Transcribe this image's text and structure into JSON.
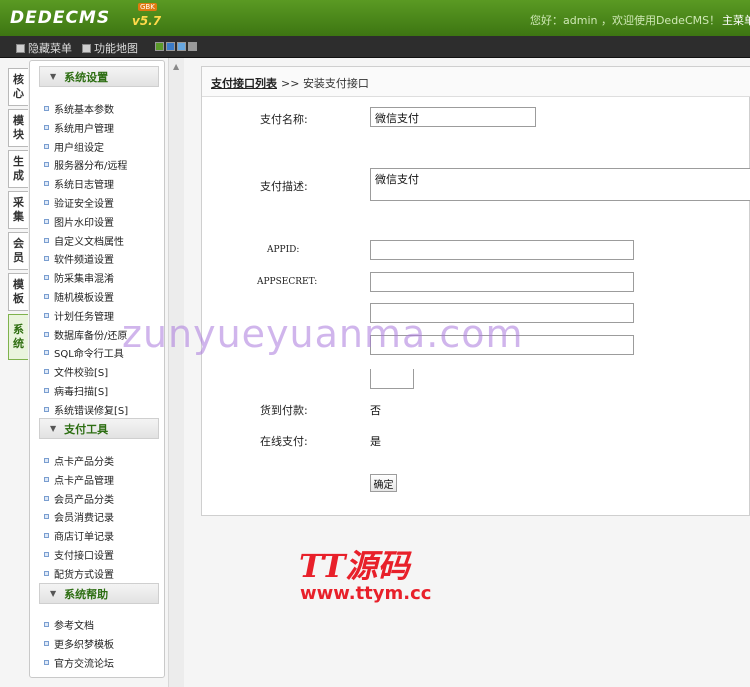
{
  "header": {
    "logo": "DEDECMS",
    "version": "v5.7",
    "badge": "GBK",
    "welcome": "您好：admin ，欢迎使用DedeCMS！",
    "nav_main": "主菜单"
  },
  "toolbar": {
    "hide_menu": "隐藏菜单",
    "function_map": "功能地图",
    "skins": [
      "#5b9a2a",
      "#3a7bc8",
      "#67a7e0",
      "#9a9a9a"
    ]
  },
  "vtabs": [
    "核心",
    "模块",
    "生成",
    "采集",
    "会员",
    "模板",
    "系统"
  ],
  "sidebar": {
    "groups": [
      {
        "title": "系统设置",
        "items": [
          "系统基本参数",
          "系统用户管理",
          "用户组设定",
          "服务器分布/远程",
          "系统日志管理",
          "验证安全设置",
          "图片水印设置",
          "自定义文档属性",
          "软件频道设置",
          "防采集串混淆",
          "随机模板设置",
          "计划任务管理",
          "数据库备份/还原",
          "SQL命令行工具",
          "文件校验[S]",
          "病毒扫描[S]",
          "系统错误修复[S]"
        ]
      },
      {
        "title": "支付工具",
        "items": [
          "点卡产品分类",
          "点卡产品管理",
          "会员产品分类",
          "会员消费记录",
          "商店订单记录",
          "支付接口设置",
          "配货方式设置"
        ]
      },
      {
        "title": "系统帮助",
        "items": [
          "参考文档",
          "更多织梦模板",
          "官方交流论坛"
        ]
      }
    ]
  },
  "breadcrumb": {
    "link": "支付接口列表",
    "separator": ">>",
    "current": "安装支付接口"
  },
  "form": {
    "pay_name_label": "支付名称:",
    "pay_name_value": "微信支付",
    "pay_desc_label": "支付描述:",
    "pay_desc_value": "微信支付",
    "appid_label": "APPID:",
    "appsecret_label": "APPSECRET:",
    "cod_label": "货到付款:",
    "cod_value": "否",
    "online_label": "在线支付:",
    "online_value": "是",
    "submit_label": "确定"
  },
  "watermarks": {
    "main": "zunyueyuanma.com",
    "logo_top": "TT源码",
    "logo_url": "www.ttym.cc"
  }
}
